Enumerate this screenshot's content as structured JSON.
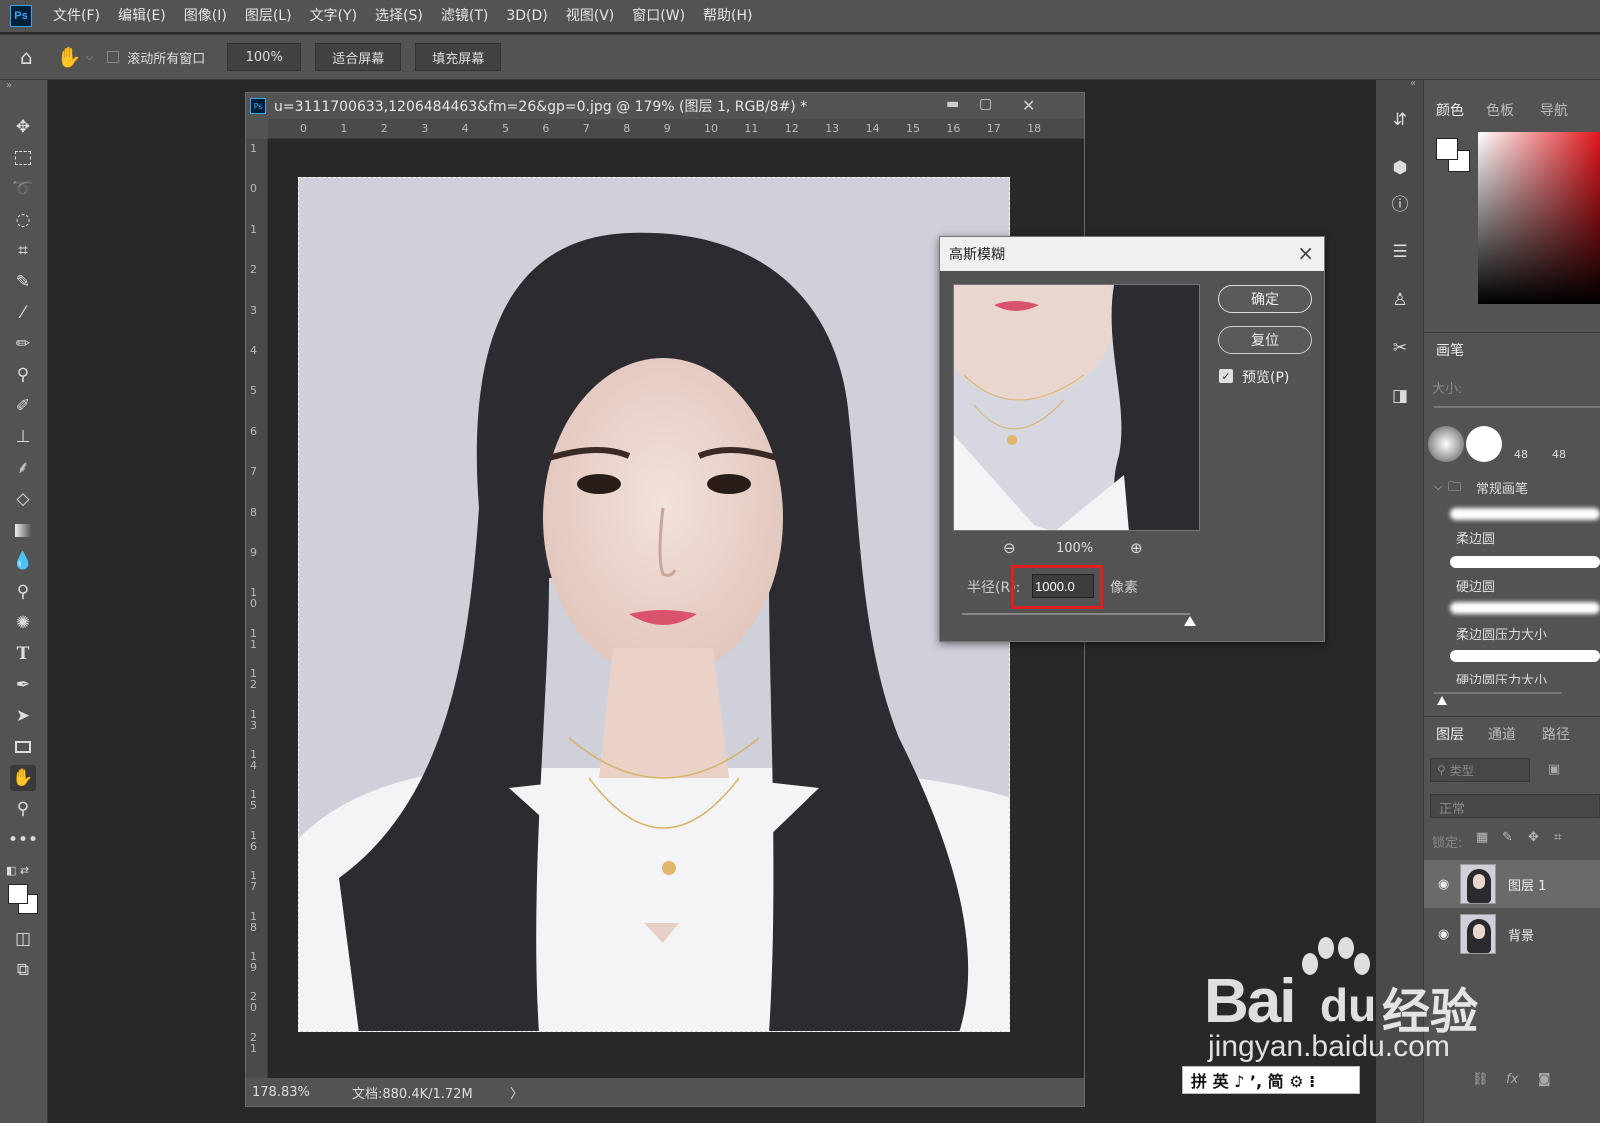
{
  "menubar": {
    "logo": "Ps",
    "items": [
      "文件(F)",
      "编辑(E)",
      "图像(I)",
      "图层(L)",
      "文字(Y)",
      "选择(S)",
      "滤镜(T)",
      "3D(D)",
      "视图(V)",
      "窗口(W)",
      "帮助(H)"
    ]
  },
  "options": {
    "scroll_all": "滚动所有窗口",
    "zoom": "100%",
    "fit_screen": "适合屏幕",
    "fill_screen": "填充屏幕"
  },
  "document": {
    "title": "u=3111700633,1206484463&fm=26&gp=0.jpg @ 179% (图层 1, RGB/8#) *",
    "zoom_status": "178.83%",
    "doc_info": "文档:880.4K/1.72M",
    "status_arrow": "〉",
    "ruler_h": [
      "0",
      "1",
      "2",
      "3",
      "4",
      "5",
      "6",
      "7",
      "8",
      "9",
      "10",
      "11",
      "12",
      "13",
      "14",
      "15",
      "16",
      "17",
      "18"
    ],
    "ruler_v": [
      "1",
      "0",
      "1",
      "2",
      "3",
      "4",
      "5",
      "6",
      "7",
      "8",
      "9",
      "10",
      "11",
      "12",
      "13",
      "14",
      "15",
      "16",
      "17",
      "18",
      "19",
      "20",
      "21"
    ]
  },
  "dialog": {
    "title": "高斯模糊",
    "ok": "确定",
    "reset": "复位",
    "preview_label": "预览(P)",
    "zoom": "100%",
    "radius_label": "半径(R):",
    "radius_value": "1000.0",
    "unit": "像素",
    "highlight_color": "#e02020"
  },
  "panels": {
    "color_tabs": [
      "颜色",
      "色板",
      "导航"
    ],
    "brush_tab": "画笔",
    "brush_size_label": "大小:",
    "brush_preset_nums": [
      "48",
      "48"
    ],
    "brush_group": "常规画笔",
    "brushes": [
      "柔边圆",
      "硬边圆",
      "柔边圆压力大小",
      "硬边圆压力大小"
    ],
    "layer_tabs": [
      "图层",
      "通道",
      "路径"
    ],
    "filter_placeholder": "类型",
    "blend_mode": "正常",
    "lock_label": "锁定:",
    "layers": [
      {
        "name": "图层 1",
        "selected": true
      },
      {
        "name": "背景",
        "selected": false
      }
    ],
    "bottom_icons": [
      "link-icon",
      "fx-icon",
      "mask-icon"
    ]
  },
  "watermark": {
    "brand": "Bai",
    "brand2": "du",
    "suffix": "经验",
    "url": "jingyan.baidu.com"
  },
  "ime": {
    "text": "拼 英 ♪ ʼ, 简 ⚙ ⁝"
  }
}
